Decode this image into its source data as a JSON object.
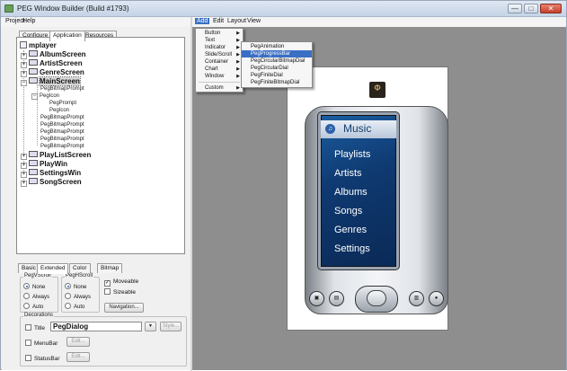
{
  "window": {
    "title": "PEG Window Builder (Build #1793)"
  },
  "left_menu": [
    "Project",
    "Help"
  ],
  "right_menu": [
    "Add",
    "Edit",
    "Layout",
    "View"
  ],
  "panel_tabs": [
    "Configure",
    "Application",
    "Resources"
  ],
  "tree": {
    "root": "mplayer",
    "items": [
      {
        "label": "AlbumScreen"
      },
      {
        "label": "ArtistScreen"
      },
      {
        "label": "GenreScreen"
      },
      {
        "label": "MainScreen"
      },
      {
        "label": "PegBitmapPrompt"
      },
      {
        "label": "PegIcon"
      },
      {
        "label": "PegPrompt"
      },
      {
        "label": "PegIcon"
      },
      {
        "label": "PegBitmapPrompt"
      },
      {
        "label": "PegBitmapPrompt"
      },
      {
        "label": "PegBitmapPrompt"
      },
      {
        "label": "PegBitmapPrompt"
      },
      {
        "label": "PegBitmapPrompt"
      },
      {
        "label": "PlayListScreen"
      },
      {
        "label": "PlayWin"
      },
      {
        "label": "SettingsWin"
      },
      {
        "label": "SongScreen"
      }
    ]
  },
  "prop_tabs": [
    "Basic",
    "Extended",
    "Color",
    "Bitmap"
  ],
  "vscroll": {
    "label": "PegVScroll",
    "options": [
      "None",
      "Always",
      "Auto"
    ],
    "selected": "None"
  },
  "hscroll": {
    "label": "PegHScroll",
    "options": [
      "None",
      "Always",
      "Auto"
    ],
    "selected": "None"
  },
  "checks": {
    "moveable": "Moveable",
    "moveable_checked": true,
    "sizeable": "Sizeable",
    "sizeable_checked": false
  },
  "navigation_button": "Navigation...",
  "decorations": {
    "label": "Decorations",
    "title_label": "Title",
    "title_value": "PegDialog",
    "style_button": "Style...",
    "menubar_label": "MenuBar",
    "statusbar_label": "StatusBar",
    "edit_label": "Edit..."
  },
  "add_menu": [
    "Button",
    "Text",
    "Indicator",
    "Slide/Scroll",
    "Container",
    "Chart",
    "Window",
    "Custom"
  ],
  "add_submenu": [
    "PegAnimation",
    "PegProgressBar",
    "PegCircularBitmapDial",
    "PegCircularDial",
    "PegFiniteDial",
    "PegFiniteBitmapDial"
  ],
  "submenu_highlight": "PegProgressBar",
  "device": {
    "header": "Music",
    "menu": [
      "Playlists",
      "Artists",
      "Albums",
      "Songs",
      "Genres",
      "Settings"
    ]
  }
}
